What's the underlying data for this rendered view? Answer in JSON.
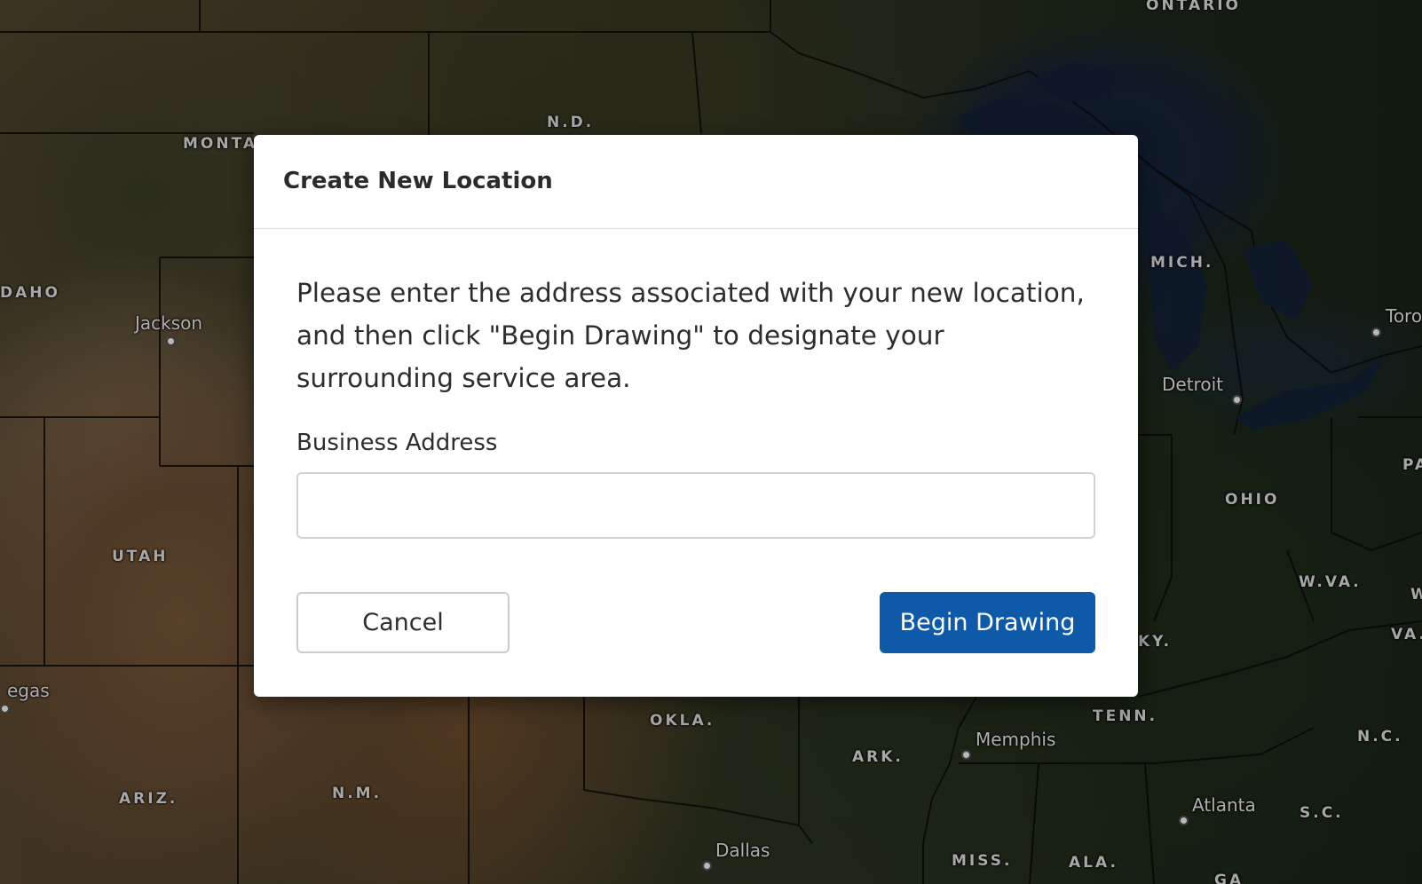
{
  "map": {
    "region_labels": [
      {
        "id": "ontario",
        "text": "ONTARIO"
      },
      {
        "id": "nd",
        "text": "N.D."
      },
      {
        "id": "montana",
        "text": "MONTA"
      },
      {
        "id": "idaho",
        "text": "DAHO"
      },
      {
        "id": "mich",
        "text": "MICH."
      },
      {
        "id": "pa",
        "text": "PA"
      },
      {
        "id": "ohio",
        "text": "OHIO"
      },
      {
        "id": "utah",
        "text": "UTAH"
      },
      {
        "id": "wva",
        "text": "W.VA."
      },
      {
        "id": "va",
        "text": "VA."
      },
      {
        "id": "w",
        "text": "W"
      },
      {
        "id": "ky",
        "text": "KY."
      },
      {
        "id": "okla",
        "text": "OKLA."
      },
      {
        "id": "tenn",
        "text": "TENN."
      },
      {
        "id": "ark",
        "text": "ARK."
      },
      {
        "id": "nc",
        "text": "N.C."
      },
      {
        "id": "ariz",
        "text": "ARIZ."
      },
      {
        "id": "nm",
        "text": "N.M."
      },
      {
        "id": "sc",
        "text": "S.C."
      },
      {
        "id": "miss",
        "text": "MISS."
      },
      {
        "id": "ala",
        "text": "ALA."
      },
      {
        "id": "ga",
        "text": "GA"
      }
    ],
    "cities": [
      {
        "id": "jackson",
        "text": "Jackson"
      },
      {
        "id": "toronto",
        "text": "Toro"
      },
      {
        "id": "detroit",
        "text": "Detroit"
      },
      {
        "id": "vegas",
        "text": "egas"
      },
      {
        "id": "memphis",
        "text": "Memphis"
      },
      {
        "id": "atlanta",
        "text": "Atlanta"
      },
      {
        "id": "dallas",
        "text": "Dallas"
      }
    ]
  },
  "modal": {
    "title": "Create New Location",
    "description": "Please enter the address associated with your new location, and then click \"Begin Drawing\" to designate your surrounding service area.",
    "address_label": "Business Address",
    "address_value": "",
    "address_placeholder": "",
    "cancel_label": "Cancel",
    "begin_label": "Begin Drawing",
    "primary_color": "#0f5aa8"
  }
}
